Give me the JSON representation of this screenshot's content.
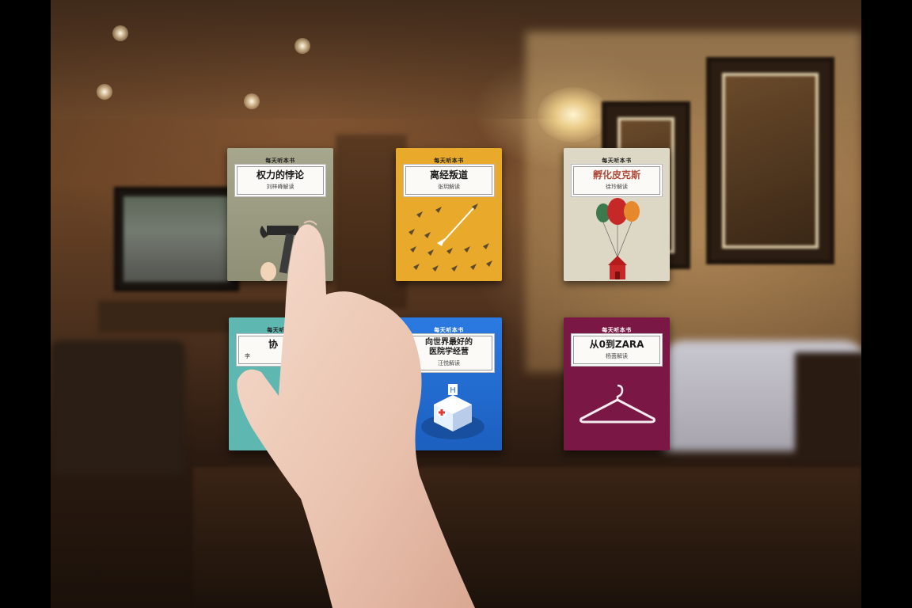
{
  "scene": {
    "description_icon": "living-room-background",
    "accent_colors": {
      "book1": "#a09f86",
      "book2": "#e9a92b",
      "book3": "#dcd8c5",
      "book4": "#5fb7b1",
      "book5": "#1f6ccf",
      "book6": "#7a1745"
    }
  },
  "books": [
    {
      "series": "每天听本书",
      "title": "权力的悖论",
      "author": "刘梓峰解读",
      "icon": "hammer-egg-icon"
    },
    {
      "series": "每天听本书",
      "title": "离经叛道",
      "author": "张玥解读",
      "icon": "paper-planes-icon"
    },
    {
      "series": "每天听本书",
      "title": "孵化皮克斯",
      "author": "徐玲解读",
      "icon": "balloon-house-icon"
    },
    {
      "series": "每天听本书",
      "title": "协",
      "author": "李",
      "icon": "teal-cover-icon"
    },
    {
      "series": "每天听本书",
      "title": "向世界最好的\n医院学经营",
      "author": "汪悦解读",
      "icon": "hospital-building-icon"
    },
    {
      "series": "每天听本书",
      "title": "从0到ZARA",
      "author": "杨茵解读",
      "icon": "clothes-hanger-icon"
    }
  ]
}
